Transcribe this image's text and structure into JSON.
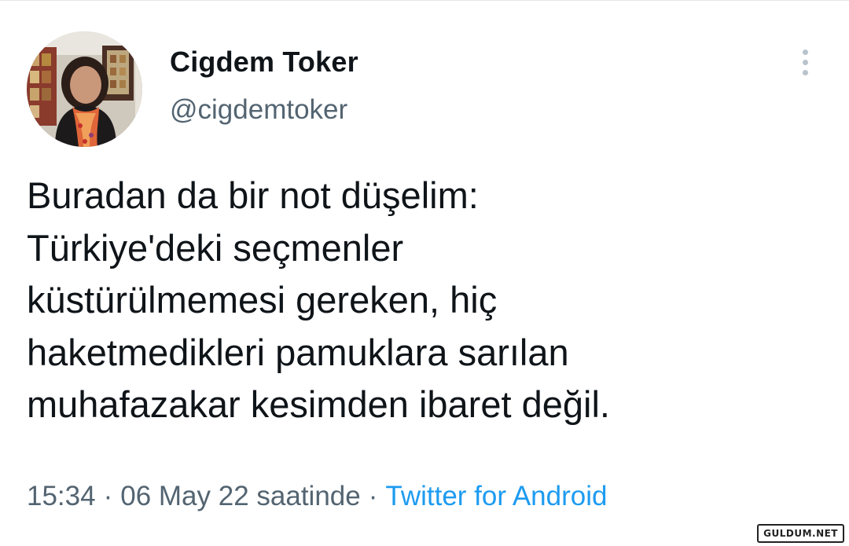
{
  "author": {
    "display_name": "Cigdem Toker",
    "handle": "@cigdemtoker",
    "avatar_icon": "profile-photo"
  },
  "menu": {
    "icon": "more-vertical-icon"
  },
  "tweet": {
    "lines": [
      "Buradan da bir not düşelim:",
      "Türkiye'deki seçmenler",
      "küstürülmemesi gereken, hiç",
      "haketmedikleri pamuklara sarılan",
      "muhafazakar kesimden ibaret değil."
    ]
  },
  "meta": {
    "time": "15:34",
    "separator": "·",
    "date": "06 May 22 saatinde",
    "source": "Twitter for Android"
  },
  "watermark": {
    "text": "GULDUM.NET"
  },
  "colors": {
    "text": "#0f1419",
    "secondary": "#536471",
    "link": "#1d9bf0",
    "menu_dots": "#b8c3cc"
  }
}
